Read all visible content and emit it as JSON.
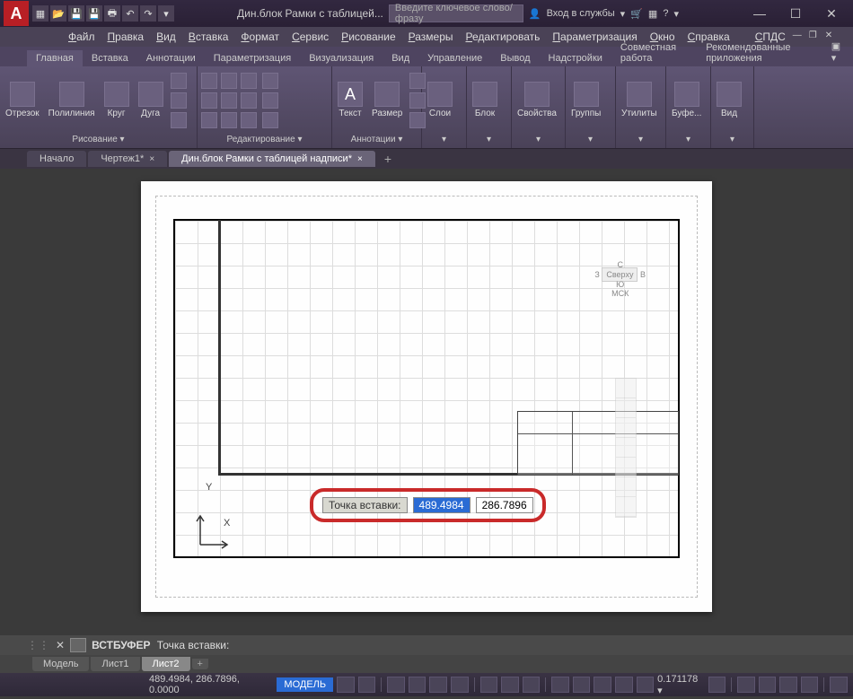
{
  "titlebar": {
    "title": "Дин.блок Рамки с таблицей...",
    "search_placeholder": "Введите ключевое слово/фразу",
    "signin": "Вход в службы"
  },
  "menu": {
    "items": [
      "Файл",
      "Правка",
      "Вид",
      "Вставка",
      "Формат",
      "Сервис",
      "Рисование",
      "Размеры",
      "Редактировать",
      "Параметризация",
      "Окно",
      "Справка",
      "СПДС"
    ]
  },
  "ribbon_tabs": [
    "Главная",
    "Вставка",
    "Аннотации",
    "Параметризация",
    "Визуализация",
    "Вид",
    "Управление",
    "Вывод",
    "Надстройки",
    "Совместная работа",
    "Рекомендованные приложения"
  ],
  "ribbon": {
    "draw": {
      "title": "Рисование ▾",
      "line": "Отрезок",
      "pline": "Полилиния",
      "circle": "Круг",
      "arc": "Дуга"
    },
    "modify": {
      "title": "Редактирование ▾"
    },
    "annot": {
      "title": "Аннотации ▾",
      "text": "Текст",
      "dim": "Размер"
    },
    "layers": {
      "title": "Слои"
    },
    "block": {
      "title": "Блок"
    },
    "props": {
      "title": "Свойства"
    },
    "groups": {
      "title": "Группы"
    },
    "utils": {
      "title": "Утилиты"
    },
    "clip": {
      "title": "Буфе..."
    },
    "view": {
      "title": "Вид"
    }
  },
  "doc_tabs": [
    {
      "label": "Начало",
      "active": false,
      "closable": false
    },
    {
      "label": "Чертеж1*",
      "active": false,
      "closable": true
    },
    {
      "label": "Дин.блок Рамки с таблицей надписи*",
      "active": true,
      "closable": true
    }
  ],
  "viewcube": {
    "c": "С",
    "z": "З",
    "top": "Сверху",
    "v": "В",
    "yu": "Ю",
    "mck": "МСК"
  },
  "ucs": {
    "x": "X",
    "y": "Y"
  },
  "dyninput": {
    "label": "Точка вставки:",
    "x": "489.4984",
    "y": "286.7896"
  },
  "cmdline": {
    "cmd": "ВСТБУФЕР",
    "prompt": "Точка вставки:"
  },
  "layout_tabs": [
    "Модель",
    "Лист1",
    "Лист2"
  ],
  "status": {
    "coords": "489.4984, 286.7896, 0.0000",
    "model": "МОДЕЛЬ",
    "scale": "0.171178"
  }
}
